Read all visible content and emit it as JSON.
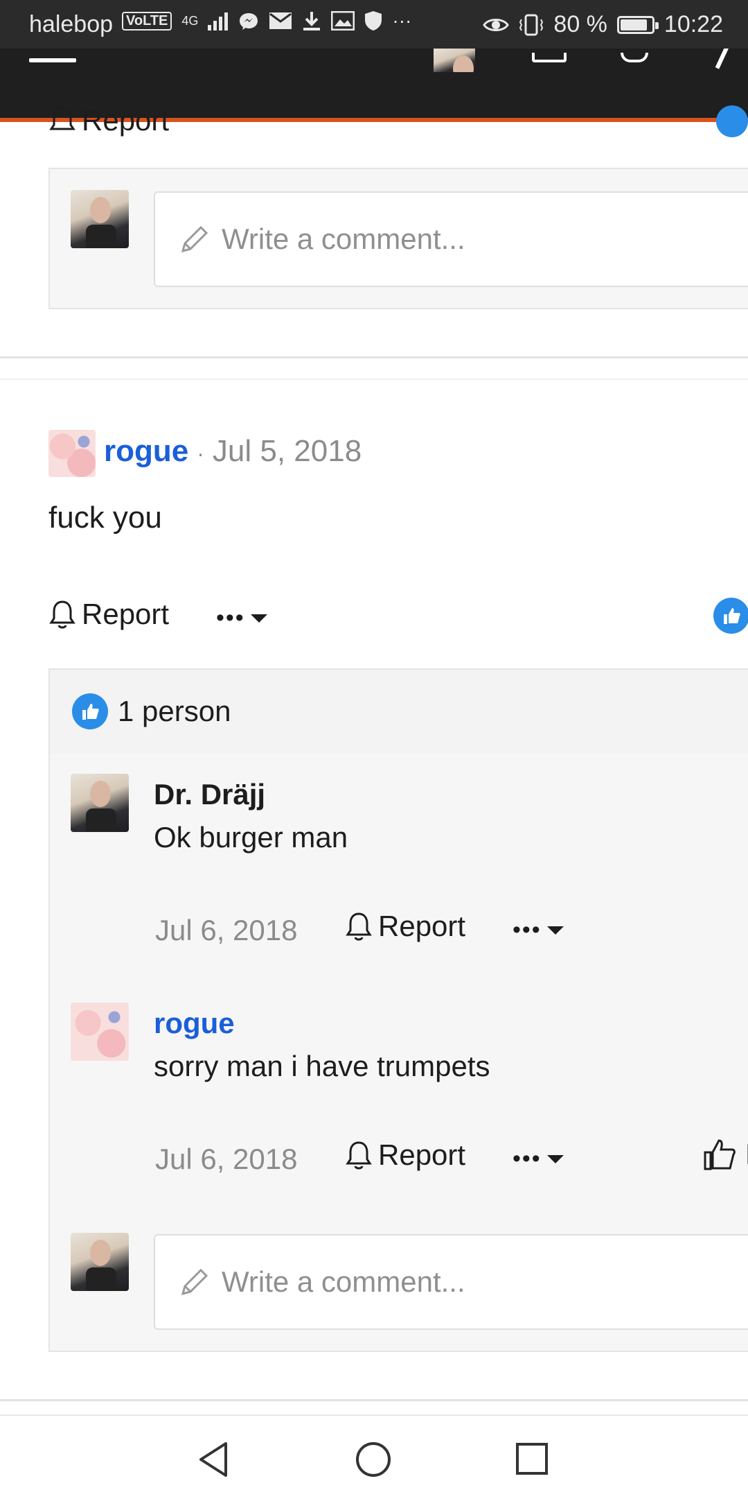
{
  "status_bar": {
    "carrier": "halebop",
    "volte": "VoLTE",
    "network": "4G",
    "battery_text": "80 %",
    "battery_level": 0.8,
    "time": "10:22",
    "icons": [
      "signal-icon",
      "messenger-icon",
      "mail-icon",
      "download-icon",
      "gallery-icon",
      "shield-icon",
      "more-icon",
      "eye-icon",
      "vibrate-icon",
      "battery-icon"
    ]
  },
  "app_header": {
    "icons": [
      "menu-icon",
      "avatar",
      "inbox-icon",
      "notifications-icon",
      "edit-icon"
    ]
  },
  "top_partial": {
    "report_label": "Report"
  },
  "comment_box_1": {
    "placeholder": "Write a comment..."
  },
  "post": {
    "author": "rogue",
    "separator": "·",
    "date": "Jul 5, 2018",
    "body": "fuck you",
    "report_label": "Report",
    "more_label": "•••"
  },
  "reactions": {
    "summary": "1 person"
  },
  "replies": [
    {
      "author": "Dr. Dräjj",
      "text": "Ok burger man",
      "date": "Jul 6, 2018",
      "report_label": "Report",
      "more_label": "•••"
    },
    {
      "author": "rogue",
      "text": "sorry man i have trumpets",
      "date": "Jul 6, 2018",
      "report_label": "Report",
      "more_label": "•••",
      "like_partial": "L"
    }
  ],
  "comment_box_2": {
    "placeholder": "Write a comment..."
  },
  "colors": {
    "accent_orange": "#d9531e",
    "link_blue": "#1a5fd8",
    "like_blue": "#2a8de8",
    "header_dark": "#1f1f1f"
  }
}
